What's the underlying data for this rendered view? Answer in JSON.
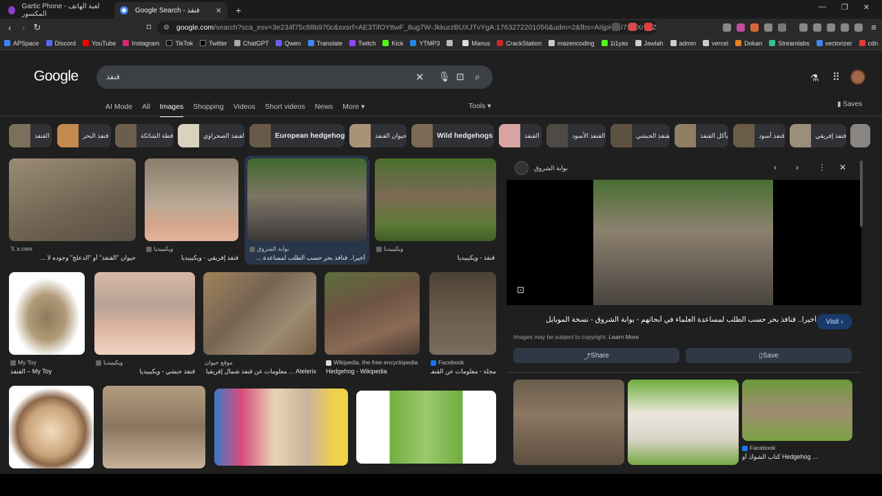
{
  "tabs": [
    {
      "label": "Gartic Phone - لعبة الهاتف المكسور",
      "active": false
    },
    {
      "label": "Google Search - قنفذ",
      "active": true
    }
  ],
  "new_tab": "+",
  "address": {
    "host": "google.com",
    "path": "/search?sca_esv=3e234f75c88b970c&sxsrf=AE3TifOYttwF_8ug7W-JkkurzBUXJTvYgA:1763272201056&udm=2&fbs=AIIjpHxU7SXXniUZfe..."
  },
  "bookmarks": [
    "APSpace",
    "Discord",
    "YouTube",
    "Instagram",
    "TikTok",
    "Twitter",
    "ChatGPT",
    "Qwen",
    "Translate",
    "Twitch",
    "Kick",
    "YTMP3",
    "",
    "Manus",
    "CrackStation",
    "mazencoding",
    "1i1yas",
    "Jawlah",
    "admin",
    "vercel",
    "Dokan",
    "Streamlabs",
    "vectorizer",
    "cdn"
  ],
  "google": {
    "logo": "Google",
    "query": "قنفذ",
    "tabs": [
      "AI Mode",
      "All",
      "Images",
      "Shopping",
      "Videos",
      "Short videos",
      "News",
      "More ▾"
    ],
    "active_tab": "Images",
    "tools": "Tools ▾",
    "saves": "Saves"
  },
  "chips": [
    "القنفذ",
    "قنفذ البحر",
    "قطة الشائكة",
    "القنفذ الصحراوي",
    "European hedgehog",
    "حيوان القنفذ",
    "Wild hedgehogs",
    "القنفذ",
    "القنفذ الأسود",
    "القنفذ الحبشي",
    "يأكل القنفذ",
    "قنفذ أسود",
    "قنفذ إفريقي"
  ],
  "results": [
    {
      "source": "x.com",
      "caption": "حيوان \"القنفذ\" أو \"الدعلج\" وجوده لا ..."
    },
    {
      "source": "ويكيبيديا",
      "caption": "قنفذ إفريقي - ويكيبيديا"
    },
    {
      "source": "بوابة الشروق",
      "caption": "أخيرا.. قنافذ بحر حسب الطلب لمساعدة ..."
    },
    {
      "source": "ويكيبيديا",
      "caption": "قنفذ - ويكيبيديا"
    },
    {
      "source": "My Toy",
      "caption": "القنفذ – My Toy"
    },
    {
      "source": "ويكيبيديا",
      "caption": "قنفذ حبشي - ويكيبيديا"
    },
    {
      "source": "موقع حيوان",
      "caption": "Atelerix ... معلومات عن قنفذ شمال إفريقيا"
    },
    {
      "source": "Wikipedia, the free encyclopedia",
      "caption": "Hedgehog - Wikipedia"
    },
    {
      "source": "Facebook",
      "caption": "مجلة - معلومات عن القنفذ ..."
    }
  ],
  "panel": {
    "source": "بوابة الشروق",
    "title": "أخيرا.. قنافذ بحر حسب الطلب لمساعدة العلماء في أبحاثهم - بوابة الشروق - نسخة الموبايل",
    "visit": "Visit ›",
    "copyright": "Images may be subject to copyright.",
    "learn_more": "Learn More",
    "share": "Share",
    "save": "Save",
    "related_source": "Facebook",
    "related_caption": "كتاب الشوك أو Hedgehog ..."
  }
}
